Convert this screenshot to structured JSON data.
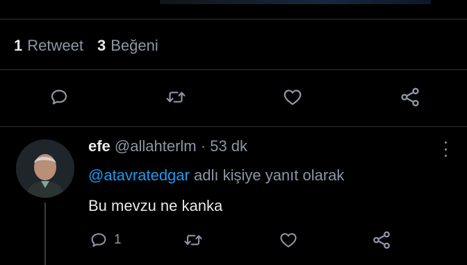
{
  "stats": {
    "retweets_count": "1",
    "retweets_label": "Retweet",
    "likes_count": "3",
    "likes_label": "Beğeni"
  },
  "tweet_actions": {
    "reply_icon": "comment-icon",
    "retweet_icon": "retweet-icon",
    "like_icon": "heart-icon",
    "share_icon": "share-icon"
  },
  "reply": {
    "display_name": "efe",
    "handle": "@allahterlm",
    "separator": "·",
    "time": "53 dk",
    "reply_to_mention": "@atavratedgar",
    "reply_to_suffix": "adlı kişiye yanıt olarak",
    "text": "Bu mevzu ne kanka",
    "reply_count": "1"
  },
  "colors": {
    "background": "#000000",
    "text": "#e7e9ea",
    "secondary": "#8b98a5",
    "accent": "#1d9bf0",
    "divider": "#2f3336"
  }
}
